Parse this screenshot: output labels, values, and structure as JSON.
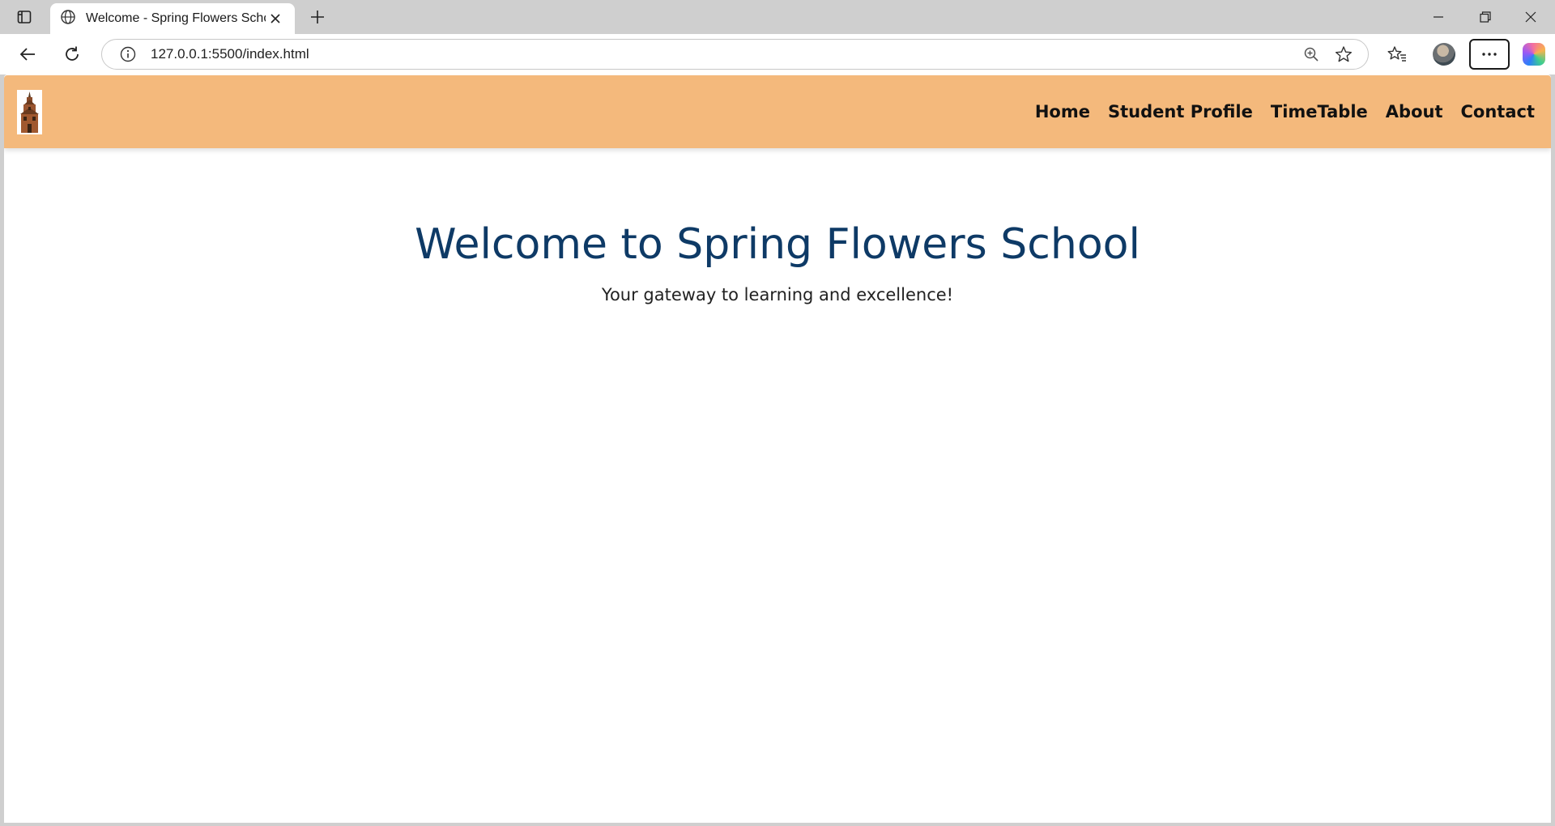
{
  "browser": {
    "tab_title": "Welcome - Spring Flowers School",
    "url": "127.0.0.1:5500/index.html",
    "icons": [
      "tab-actions-icon",
      "globe-icon",
      "close-icon",
      "plus-icon",
      "minimize-icon",
      "restore-icon",
      "window-close-icon",
      "back-icon",
      "reload-icon",
      "info-icon",
      "zoom-icon",
      "star-icon",
      "favorites-icon",
      "profile-avatar",
      "more-icon",
      "copilot-icon"
    ]
  },
  "site": {
    "logo_icon": "school-building-icon",
    "nav": [
      {
        "label": "Home"
      },
      {
        "label": "Student Profile"
      },
      {
        "label": "TimeTable"
      },
      {
        "label": "About"
      },
      {
        "label": "Contact"
      }
    ],
    "header_color": "#f4b97c",
    "title_color": "#0e3a66"
  },
  "hero": {
    "title": "Welcome to Spring Flowers School",
    "subtitle": "Your gateway to learning and excellence!"
  }
}
